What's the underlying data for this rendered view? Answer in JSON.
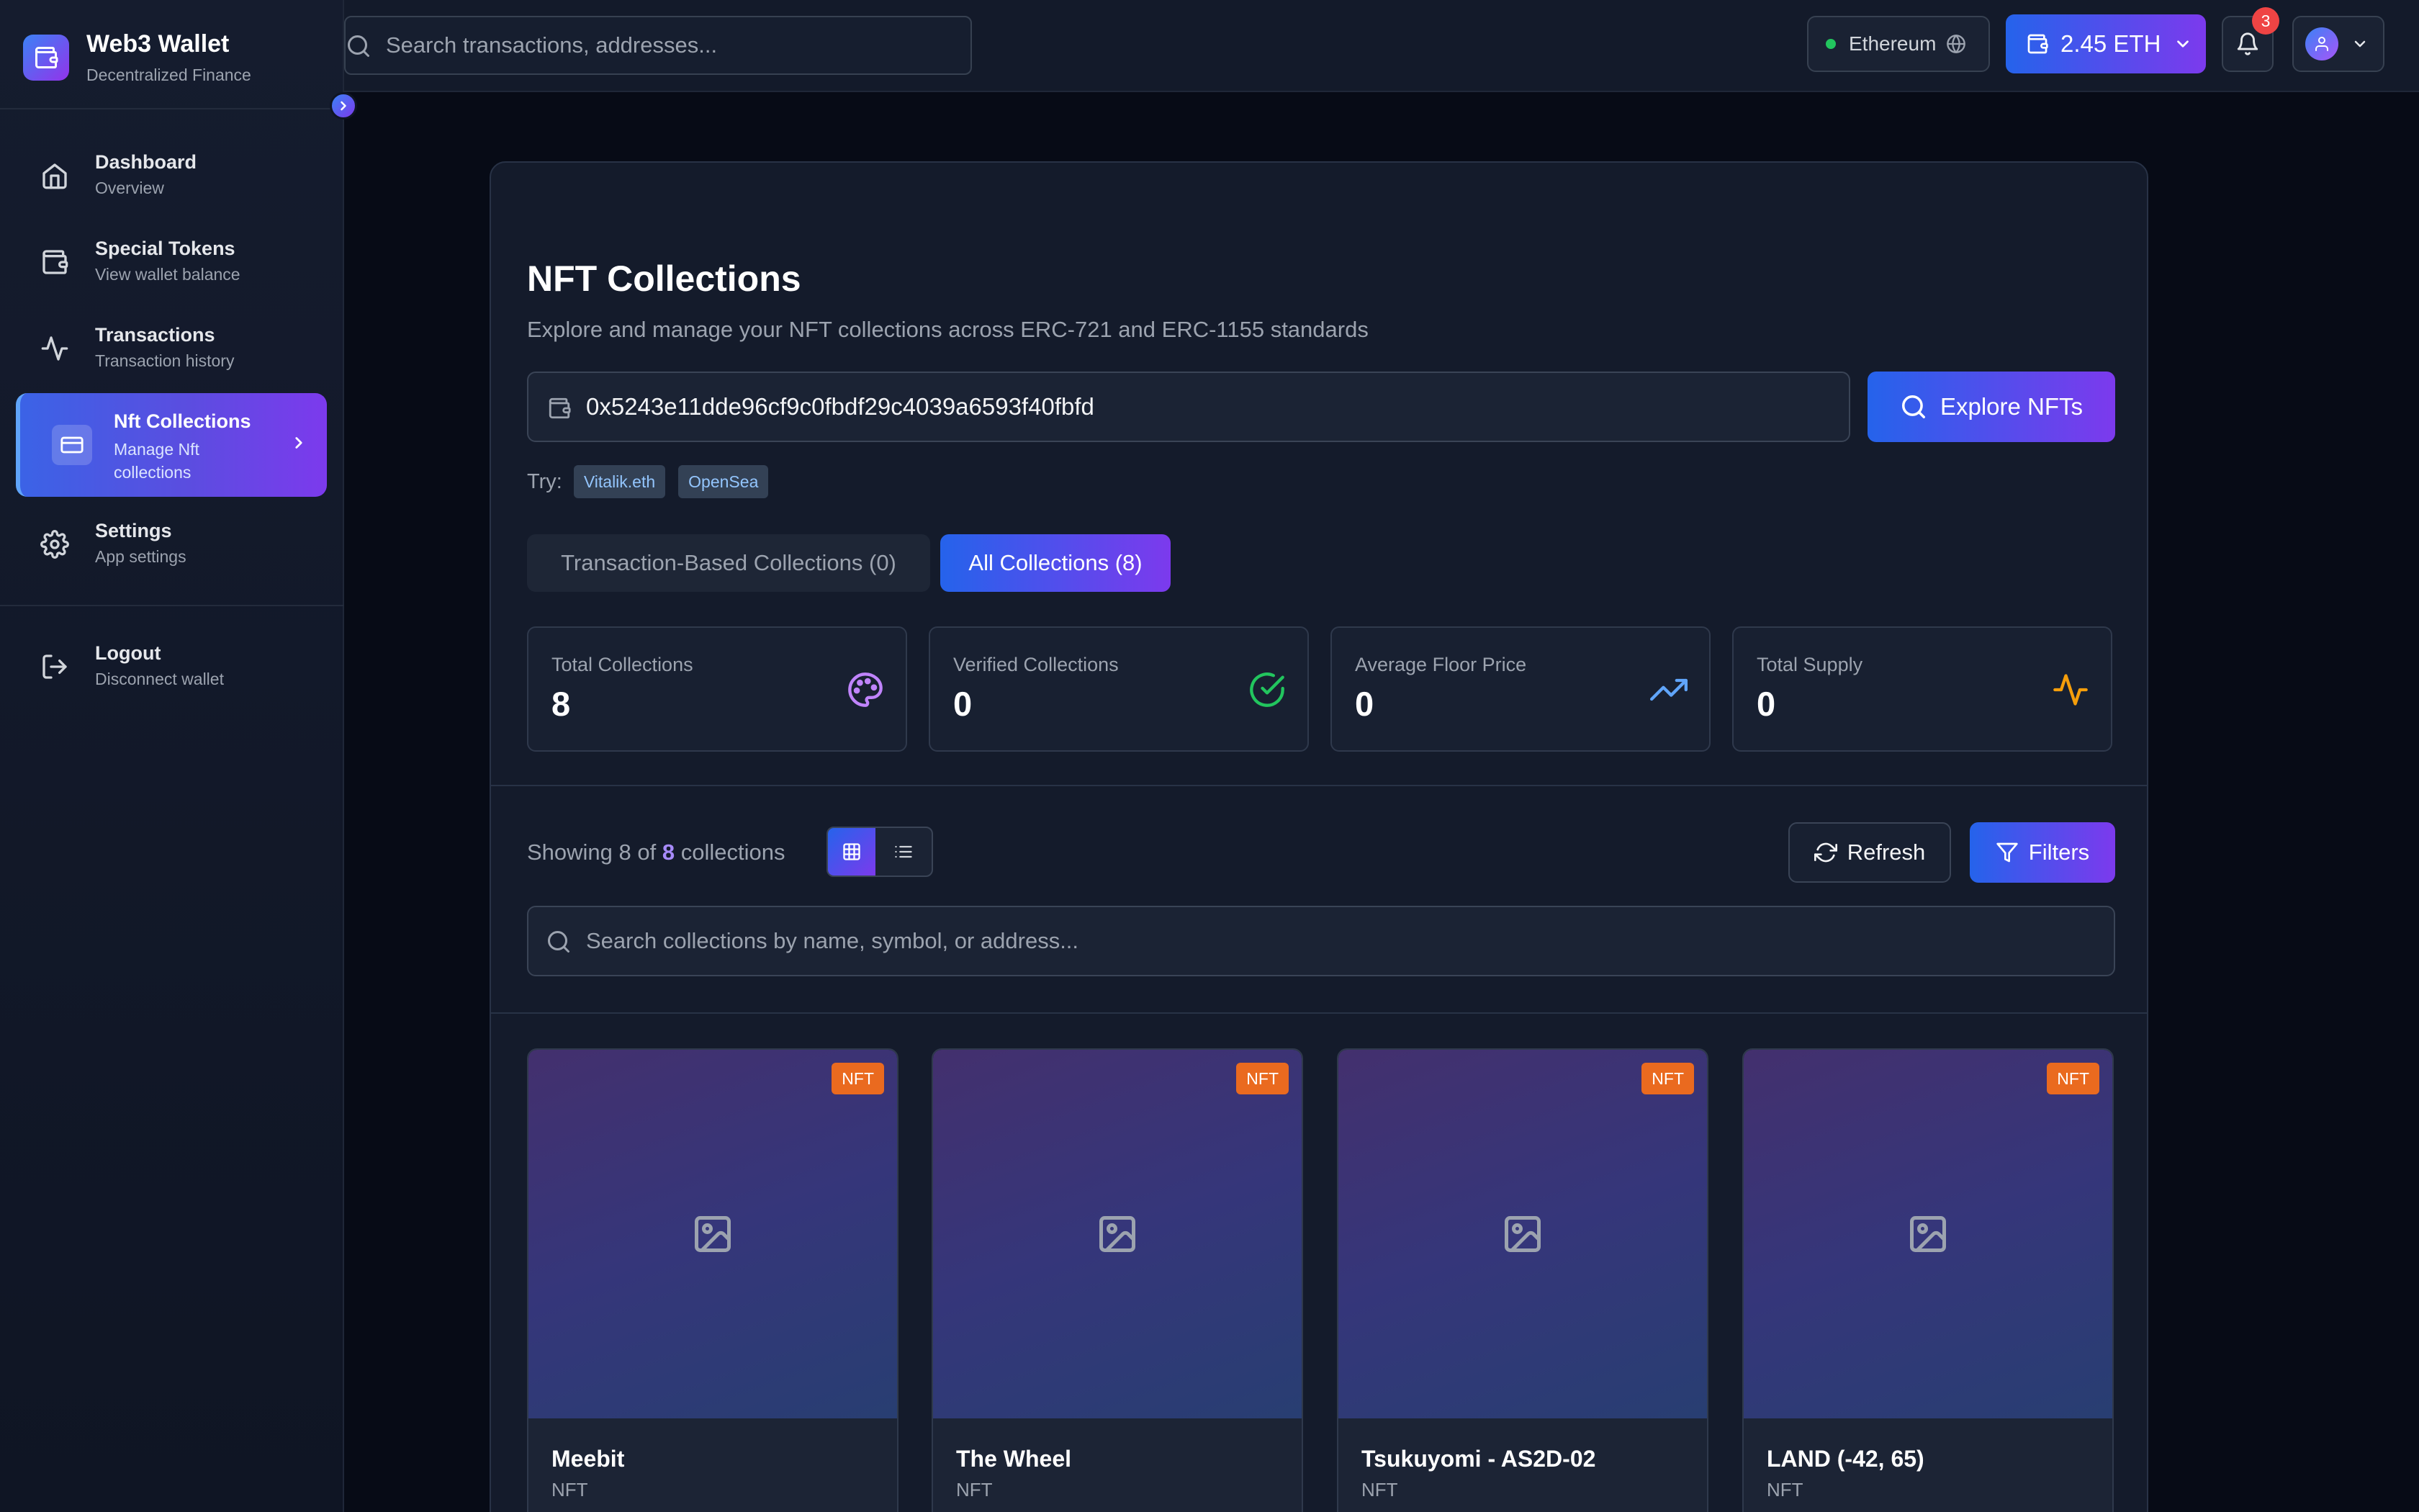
{
  "brand": {
    "title": "Web3 Wallet",
    "subtitle": "Decentralized Finance"
  },
  "sidebar": {
    "items": [
      {
        "label": "Dashboard",
        "sub": "Overview",
        "icon": "home-icon"
      },
      {
        "label": "Special Tokens",
        "sub": "View wallet balance",
        "icon": "wallet-icon"
      },
      {
        "label": "Transactions",
        "sub": "Transaction history",
        "icon": "activity-icon"
      },
      {
        "label": "Nft Collections",
        "sub": "Manage Nft collections",
        "icon": "card-icon",
        "active": true
      },
      {
        "label": "Settings",
        "sub": "App settings",
        "icon": "gear-icon"
      }
    ],
    "logout": {
      "label": "Logout",
      "sub": "Disconnect wallet"
    }
  },
  "topbar": {
    "search_placeholder": "Search transactions, addresses...",
    "network": "Ethereum",
    "balance": "2.45 ETH",
    "notification_count": "3"
  },
  "page": {
    "title": "NFT Collections",
    "subtitle": "Explore and manage your NFT collections across ERC-721 and ERC-1155 standards",
    "address_value": "0x5243e11dde96cf9c0fbdf29c4039a6593f40fbfd",
    "explore_label": "Explore NFTs",
    "try_label": "Try:",
    "try_chips": [
      "Vitalik.eth",
      "OpenSea"
    ],
    "tabs": [
      "Transaction-Based Collections (0)",
      "All Collections (8)"
    ],
    "active_tab": 1
  },
  "stats": [
    {
      "label": "Total Collections",
      "value": "8",
      "icon": "palette-icon",
      "color": "#c084fc"
    },
    {
      "label": "Verified Collections",
      "value": "0",
      "icon": "check-circle-icon",
      "color": "#22c55e"
    },
    {
      "label": "Average Floor Price",
      "value": "0",
      "icon": "trending-up-icon",
      "color": "#60a5fa"
    },
    {
      "label": "Total Supply",
      "value": "0",
      "icon": "activity-icon",
      "color": "#f59e0b"
    }
  ],
  "listing": {
    "showing_prefix": "Showing 8 of",
    "showing_count": "8",
    "showing_suffix": "collections",
    "refresh_label": "Refresh",
    "filters_label": "Filters",
    "search_placeholder": "Search collections by name, symbol, or address..."
  },
  "collections": [
    {
      "name": "Meebit",
      "type": "NFT",
      "badge": "NFT"
    },
    {
      "name": "The Wheel",
      "type": "NFT",
      "badge": "NFT"
    },
    {
      "name": "Tsukuyomi - AS2D-02",
      "type": "NFT",
      "badge": "NFT"
    },
    {
      "name": "LAND (-42, 65)",
      "type": "NFT",
      "badge": "NFT"
    }
  ],
  "colors": {
    "accent_start": "#2563eb",
    "accent_end": "#7c3aed",
    "badge": "#ea6a1f"
  }
}
